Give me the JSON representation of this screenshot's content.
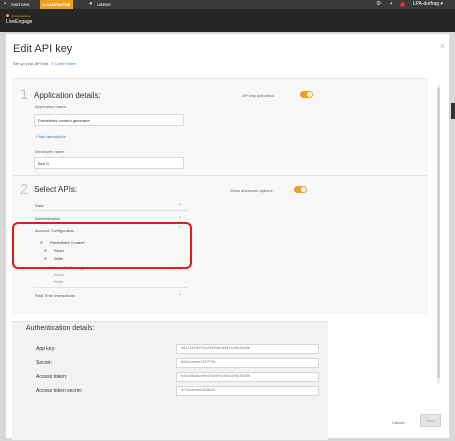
{
  "topbar": {
    "tabs": [
      {
        "label": "VISITORS",
        "active": false
      },
      {
        "label": "CAMPAIGNS",
        "active": true
      },
      {
        "label": "USERS",
        "active": false
      }
    ],
    "user_label": "LPA-dotfrag",
    "active_color": "#f0a020"
  },
  "brand": {
    "sub": "conversational",
    "main": "LiveEngage"
  },
  "modal": {
    "title": "Edit API key",
    "subtitle": "Set up your API key.",
    "learn_more": "Learn more",
    "close_icon": "×"
  },
  "step1": {
    "number": "1",
    "title": "Application details:",
    "activation_label": "API key activation",
    "app_name_label": "Application name:",
    "app_name_value": "Predefined content generator",
    "add_description": "+ Add description",
    "developer_label": "Developer name:",
    "developer_value": "Ben S"
  },
  "step2": {
    "number": "2",
    "title": "Select APIs:",
    "show_advanced": "Show advanced options",
    "rows": [
      {
        "label": "Data"
      },
      {
        "label": "Administration"
      },
      {
        "label": "Account Configuration"
      }
    ],
    "account_items": {
      "predefined": "Predefined Content",
      "read": "Read",
      "write": "Write",
      "automatic": "Automatic Messages",
      "auto_read": "Read",
      "auto_write": "Write"
    },
    "realtime": "Real Time Interactions"
  },
  "auth": {
    "title": "Authentication details:",
    "rows": [
      {
        "label": "App key:",
        "value": "d8171ef8153c4404b81a38fcc0b49a8e"
      },
      {
        "label": "Secret:",
        "value": "6a82ceeeef527f3b"
      },
      {
        "label": "Access token:",
        "value": "b4ad264ace0c47a08f4c064d70b26360"
      },
      {
        "label": "Access token secret:",
        "value": "4f34e9edbb938945"
      }
    ]
  },
  "footer": {
    "cancel": "Cancel",
    "save": "Save"
  }
}
